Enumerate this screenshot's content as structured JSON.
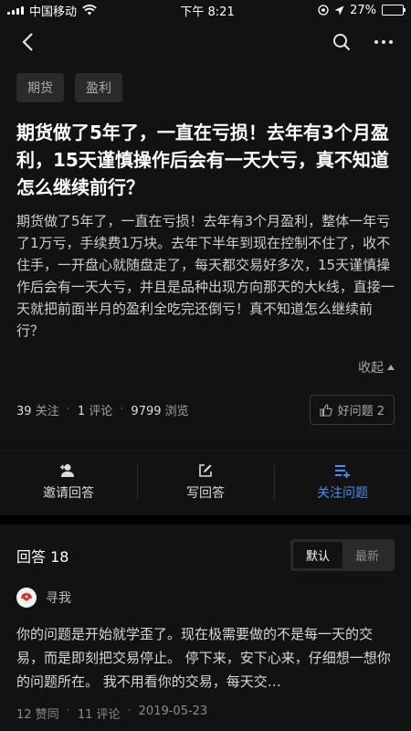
{
  "status": {
    "carrier": "中国移动",
    "time": "下午 8:21",
    "battery": "27%",
    "battery_level": 0.27
  },
  "nav": {
    "back_icon": "back-arrow-icon",
    "search_icon": "search-icon",
    "more_icon": "more-icon"
  },
  "tags": [
    "期货",
    "盈利"
  ],
  "question": {
    "title": "期货做了5年了，一直在亏损！去年有3个月盈利，15天谨慎操作后会有一天大亏，真不知道怎么继续前行？",
    "description": "期货做了5年了，一直在亏损！去年有3个月盈利，整体一年亏了1万亏，手续费1万块。去年下半年到现在控制不住了，收不住手，一开盘心就随盘走了，每天都交易好多次，15天谨慎操作后会有一天大亏，并且是品种出现方向那天的大k线，直接一天就把前面半月的盈利全吃完还倒亏！真不知道怎么继续前行？",
    "collapse_label": "收起",
    "follow_count": "39",
    "follow_label": "关注",
    "comment_count": "1",
    "comment_label": "评论",
    "view_count": "9799",
    "view_label": "浏览",
    "good_question_label": "好问题 2"
  },
  "actions": {
    "invite": "邀请回答",
    "write": "写回答",
    "follow": "关注问题"
  },
  "answers": {
    "header": "回答 18",
    "sort_default": "默认",
    "sort_latest": "最新",
    "items": [
      {
        "author": "寻我",
        "text": "你的问题是开始就学歪了。现在极需要做的不是每一天的交易，而是即刻把交易停止。 停下来，安下心来，仔细想一想你的问题所在。 我不用看你的交易，每天交…",
        "likes": "12 赞同",
        "comments": "11 评论",
        "date": "2019-05-23"
      }
    ]
  }
}
